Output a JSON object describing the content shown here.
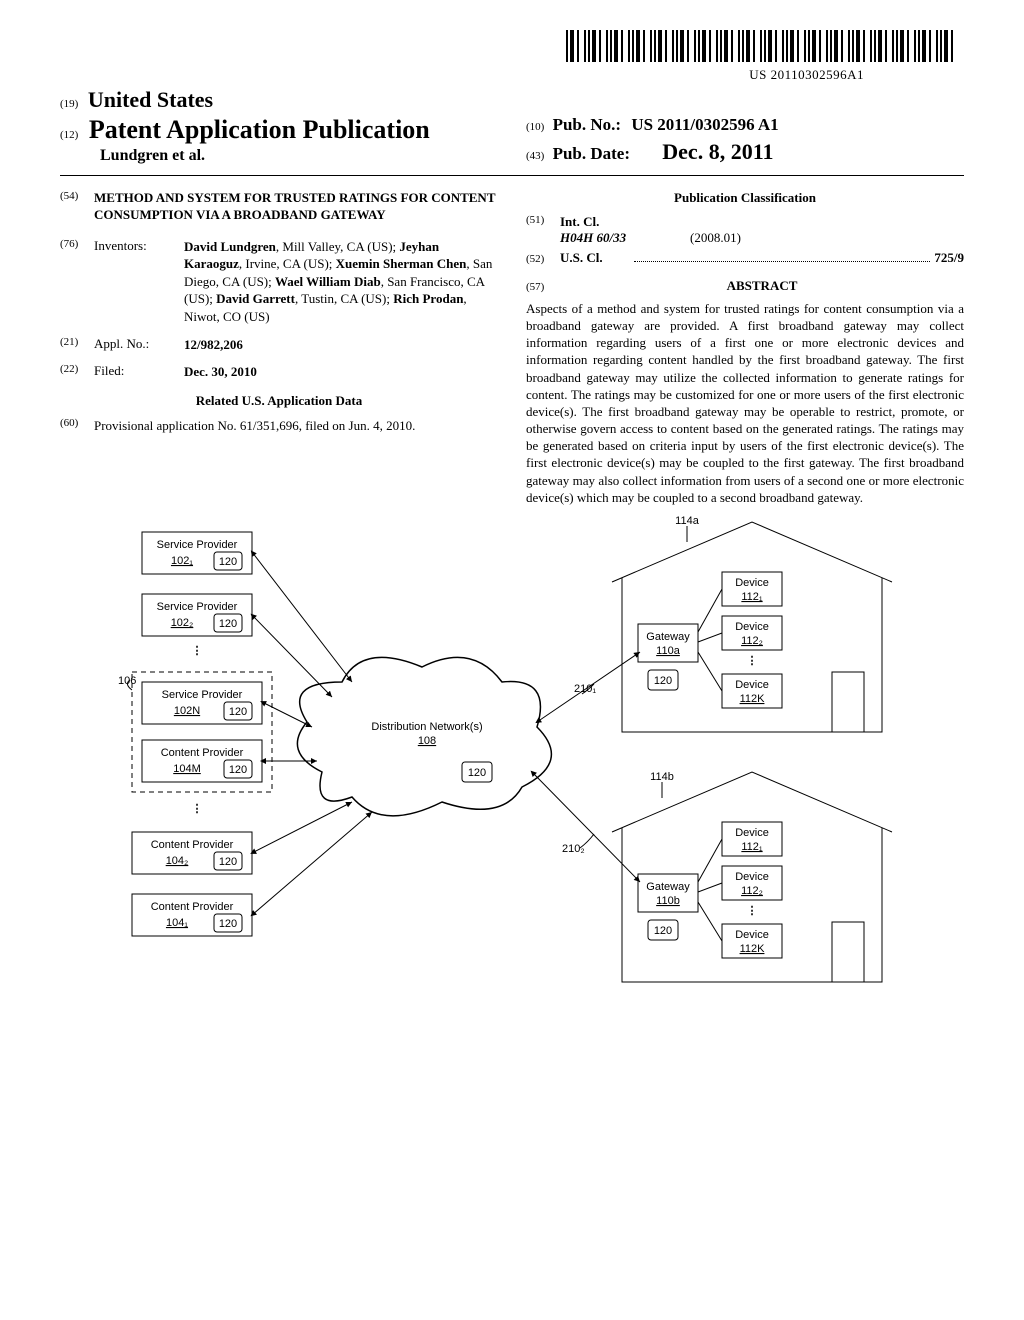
{
  "barcode_number": "US 20110302596A1",
  "header": {
    "country_code": "(19)",
    "country": "United States",
    "pub_type_code": "(12)",
    "pub_type": "Patent Application Publication",
    "authors_line": "Lundgren et al.",
    "pubno_code": "(10)",
    "pubno_label": "Pub. No.:",
    "pubno_value": "US 2011/0302596 A1",
    "pubdate_code": "(43)",
    "pubdate_label": "Pub. Date:",
    "pubdate_value": "Dec. 8, 2011"
  },
  "left_col": {
    "title_code": "(54)",
    "title": "METHOD AND SYSTEM FOR TRUSTED RATINGS FOR CONTENT CONSUMPTION VIA A BROADBAND GATEWAY",
    "inventors_code": "(76)",
    "inventors_label": "Inventors:",
    "inventors_html": "<b>David Lundgren</b>, Mill Valley, CA (US); <b>Jeyhan Karaoguz</b>, Irvine, CA (US); <b>Xuemin Sherman Chen</b>, San Diego, CA (US); <b>Wael William Diab</b>, San Francisco, CA (US); <b>David Garrett</b>, Tustin, CA (US); <b>Rich Prodan</b>, Niwot, CO (US)",
    "applno_code": "(21)",
    "applno_label": "Appl. No.:",
    "applno_value": "12/982,206",
    "filed_code": "(22)",
    "filed_label": "Filed:",
    "filed_value": "Dec. 30, 2010",
    "related_heading": "Related U.S. Application Data",
    "provisional_code": "(60)",
    "provisional_text": "Provisional application No. 61/351,696, filed on Jun. 4, 2010."
  },
  "right_col": {
    "pubclass_heading": "Publication Classification",
    "intcl_code": "(51)",
    "intcl_label": "Int. Cl.",
    "intcl_class": "H04H 60/33",
    "intcl_year": "(2008.01)",
    "uscl_code": "(52)",
    "uscl_label": "U.S. Cl.",
    "uscl_value": "725/9",
    "abstract_code": "(57)",
    "abstract_heading": "ABSTRACT",
    "abstract_text": "Aspects of a method and system for trusted ratings for content consumption via a broadband gateway are provided. A first broadband gateway may collect information regarding users of a first one or more electronic devices and information regarding content handled by the first broadband gateway. The first broadband gateway may utilize the collected information to generate ratings for content. The ratings may be customized for one or more users of the first electronic device(s). The first broadband gateway may be operable to restrict, promote, or otherwise govern access to content based on the generated ratings. The ratings may be generated based on criteria input by users of the first electronic device(s). The first electronic device(s) may be coupled to the first gateway. The first broadband gateway may also collect information from users of a second one or more electronic device(s) which may be coupled to a second broadband gateway."
  },
  "figure": {
    "sp1": "Service Provider",
    "sp1_ref": "102₁",
    "sp2": "Service Provider",
    "sp2_ref": "102₂",
    "spn": "Service Provider",
    "spn_ref": "102N",
    "cpm": "Content Provider",
    "cpm_ref": "104M",
    "cp2": "Content Provider",
    "cp2_ref": "104₂",
    "cp1": "Content Provider",
    "cp1_ref": "104₁",
    "cloud": "Distribution Network(s)",
    "cloud_ref": "108",
    "group_ref": "106",
    "storage": "120",
    "conn1": "210₁",
    "conn2": "210₂",
    "house1_ref": "114a",
    "house2_ref": "114b",
    "gateway1": "Gateway",
    "gateway1_ref": "110a",
    "gateway2": "Gateway",
    "gateway2_ref": "110b",
    "device": "Device",
    "dev1_ref": "112₁",
    "dev2_ref": "112₂",
    "devk_ref": "112K"
  }
}
